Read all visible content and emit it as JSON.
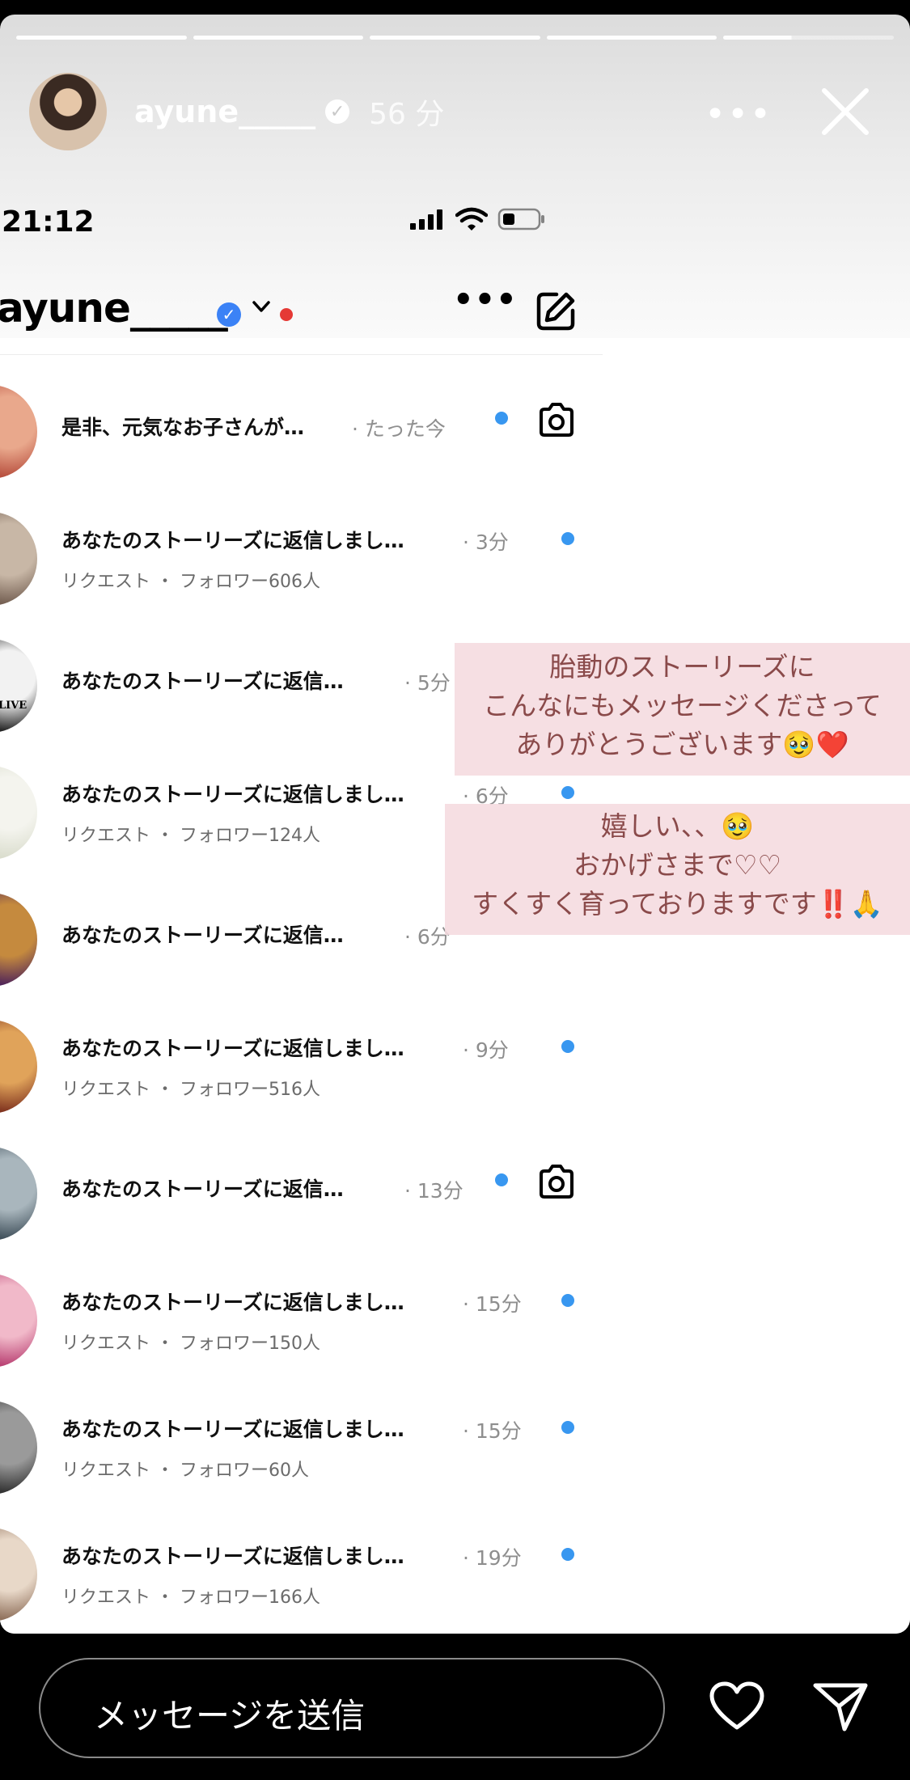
{
  "story": {
    "username": "ayune_____",
    "time": "56 分",
    "more": "•••",
    "segments": 5
  },
  "status_bar": {
    "time": "21:12"
  },
  "inbox": {
    "username": "ayune_____",
    "more": "•••"
  },
  "threads": [
    {
      "title": "是非、元気なお子さんが…",
      "time": "· たった今",
      "sub": "",
      "unread": true,
      "camera": true,
      "colors": [
        "#b54a3a",
        "#e9a88c"
      ]
    },
    {
      "title": "あなたのストーリーズに返信しまし…",
      "time": "· 3分",
      "sub": "リクエスト ・ フォロワー606人",
      "unread": true,
      "camera": false,
      "colors": [
        "#6f5a4d",
        "#c8b7a6"
      ]
    },
    {
      "title": "あなたのストーリーズに返信…",
      "time": "· 5分",
      "sub": "",
      "unread": false,
      "camera": false,
      "colors": [
        "#1a1a1a",
        "#f2f2f2"
      ],
      "badge": "LIVE"
    },
    {
      "title": "あなたのストーリーズに返信しまし…",
      "time": "· 6分",
      "sub": "リクエスト ・ フォロワー124人",
      "unread": true,
      "camera": false,
      "colors": [
        "#d9dccc",
        "#f4f4ee"
      ]
    },
    {
      "title": "あなたのストーリーズに返信…",
      "time": "· 6分",
      "sub": "",
      "unread": false,
      "camera": false,
      "colors": [
        "#4a1f5a",
        "#c58a3e"
      ]
    },
    {
      "title": "あなたのストーリーズに返信しまし…",
      "time": "· 9分",
      "sub": "リクエスト ・ フォロワー516人",
      "unread": true,
      "camera": false,
      "colors": [
        "#7a2d1c",
        "#e0a35a"
      ]
    },
    {
      "title": "あなたのストーリーズに返信…",
      "time": "· 13分",
      "sub": "",
      "unread": true,
      "camera": true,
      "colors": [
        "#3a4a55",
        "#a9b6bd"
      ]
    },
    {
      "title": "あなたのストーリーズに返信しまし…",
      "time": "· 15分",
      "sub": "リクエスト ・ フォロワー150人",
      "unread": true,
      "camera": false,
      "colors": [
        "#b63a6e",
        "#f1b9c9"
      ]
    },
    {
      "title": "あなたのストーリーズに返信しまし…",
      "time": "· 15分",
      "sub": "リクエスト ・ フォロワー60人",
      "unread": true,
      "camera": false,
      "colors": [
        "#2b2b2b",
        "#9a9a9a"
      ]
    },
    {
      "title": "あなたのストーリーズに返信しまし…",
      "time": "· 19分",
      "sub": "リクエスト ・ フォロワー166人",
      "unread": true,
      "camera": false,
      "colors": [
        "#8a6a55",
        "#e8d8c8"
      ]
    }
  ],
  "notes": [
    {
      "lines": [
        "胎動のストーリーズに",
        "こんなにもメッセージくださって",
        "ありがとうございます🥹❤️"
      ]
    },
    {
      "lines": [
        "嬉しい、、🥹",
        "おかげさまで♡♡",
        "すくすく育っておりますです‼️🙏"
      ]
    }
  ],
  "footer": {
    "placeholder": "メッセージを送信"
  }
}
